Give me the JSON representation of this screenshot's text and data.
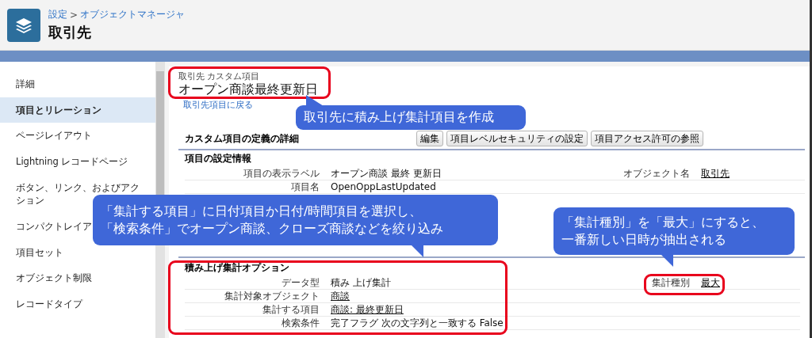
{
  "header": {
    "breadcrumb": [
      {
        "label": "設定"
      },
      {
        "label": "オブジェクトマネージャ"
      }
    ],
    "separator": ">",
    "title": "取引先"
  },
  "sidebar": {
    "items": [
      {
        "label": "詳細",
        "selected": false
      },
      {
        "label": "項目とリレーション",
        "selected": true
      },
      {
        "label": "ページレイアウト",
        "selected": false
      },
      {
        "label": "Lightning レコードページ",
        "selected": false
      },
      {
        "label": "ボタン、リンク、およびアクション",
        "selected": false
      },
      {
        "label": "コンパクトレイア",
        "selected": false
      },
      {
        "label": "項目セット",
        "selected": false
      },
      {
        "label": "オブジェクト制限",
        "selected": false
      },
      {
        "label": "レコードタイプ",
        "selected": false
      }
    ]
  },
  "field": {
    "object_label": "取引先 カスタム項目",
    "title": "オープン商談最終更新日",
    "back_link": "取引先項目に戻る"
  },
  "detail": {
    "title": "カスタム項目の定義の詳細",
    "buttons": [
      "編集",
      "項目レベルセキュリティの設定",
      "項目アクセス許可の参照"
    ],
    "sections": [
      {
        "title": "項目の設定情報",
        "rows": [
          {
            "label": "項目の表示ラベル",
            "value": "オープン商談 最終 更新日",
            "link": false,
            "side_label": "オブジェクト名",
            "side_value": "取引先"
          },
          {
            "label": "項目名",
            "value": "OpenOppLastUpdated",
            "link": false
          }
        ]
      },
      {
        "title": "積み上げ集計オプション",
        "rows": [
          {
            "label": "データ型",
            "value": "積み 上げ集計",
            "link": false,
            "side_label": "集計種別",
            "side_value": "最大"
          },
          {
            "label": "集計対象オブジェクト",
            "value": "商談",
            "link": true
          },
          {
            "label": "集計する項目",
            "value": "商談: 最終更新日",
            "link": true
          },
          {
            "label": "検索条件",
            "value": "完了フラグ 次の文字列と一致する False",
            "link": false
          }
        ]
      }
    ]
  },
  "callouts": [
    {
      "lines": [
        "取引先に積み上げ集計項目を作成"
      ]
    },
    {
      "lines": [
        "「集計する項目」に日付項目か日付/時間項目を選択し、",
        "「検索条件」でオープン商談、クローズ商談などを絞り込み"
      ]
    },
    {
      "lines": [
        "「集計種別」を「最大」にすると、",
        "一番新しい日時が抽出される"
      ]
    }
  ]
}
